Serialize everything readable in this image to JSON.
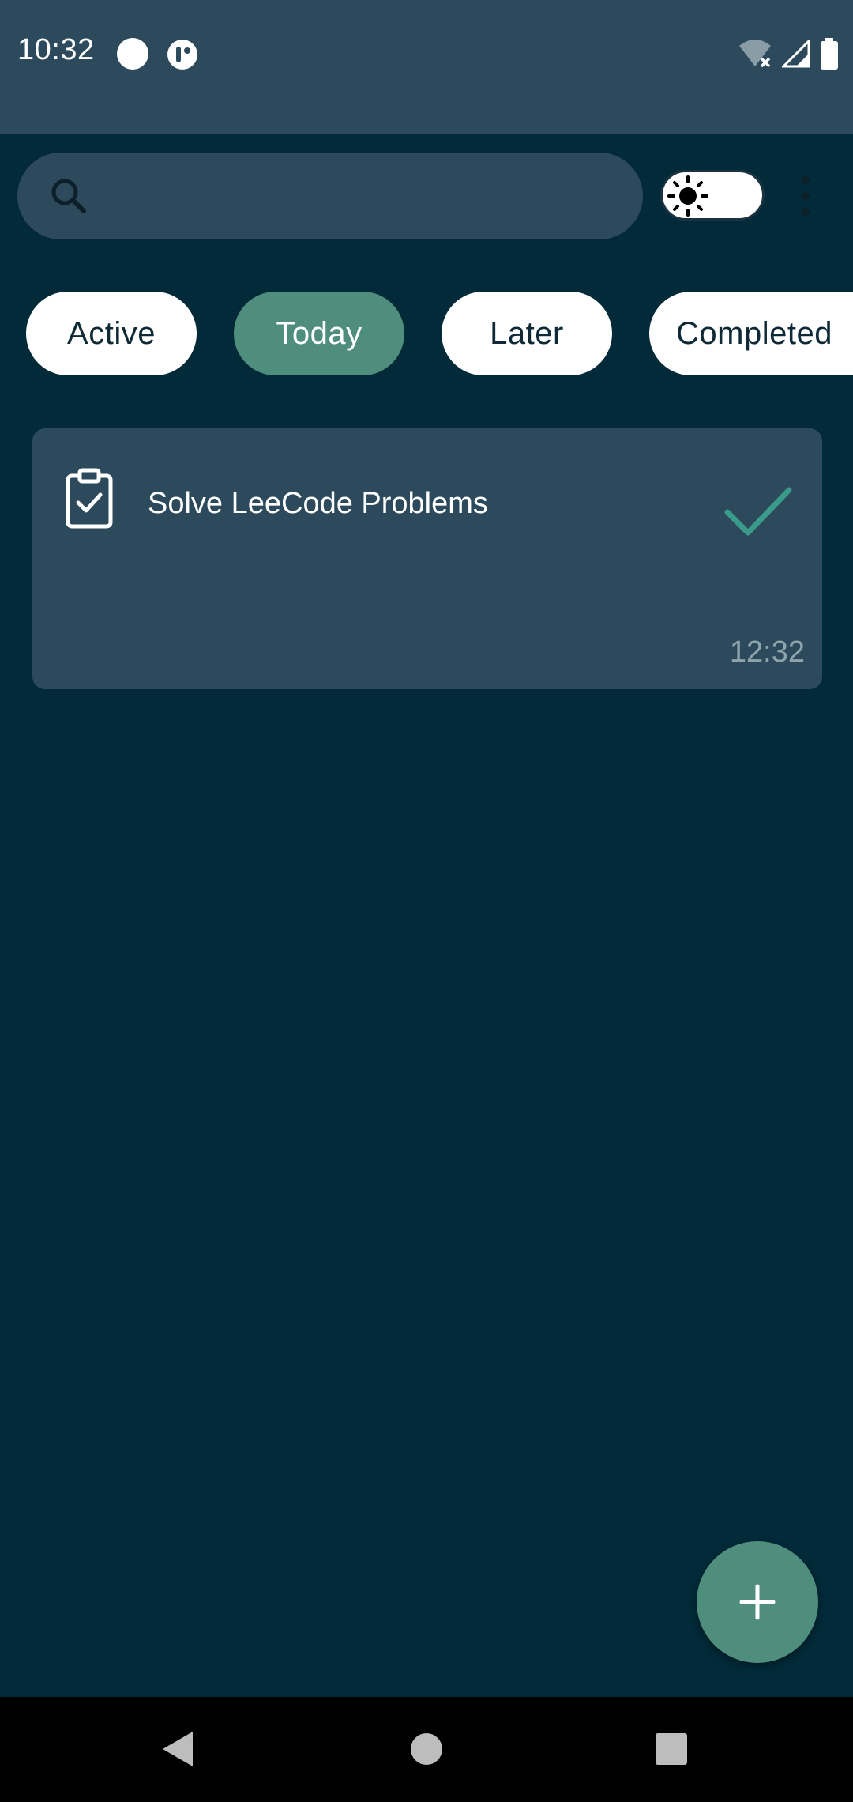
{
  "status_bar": {
    "time": "10:32",
    "icons": [
      "notification-dot-icon",
      "app-notification-icon",
      "wifi-off-icon",
      "cell-signal-icon",
      "battery-icon"
    ]
  },
  "search": {
    "placeholder": "",
    "value": "",
    "icon": "search-icon"
  },
  "theme_toggle": {
    "icon": "sun-icon",
    "state": "light"
  },
  "overflow_menu": {
    "icon": "more-vert-icon"
  },
  "tabs": [
    {
      "label": "Active",
      "selected": false
    },
    {
      "label": "Today",
      "selected": true
    },
    {
      "label": "Later",
      "selected": false
    },
    {
      "label": "Completed",
      "selected": false
    }
  ],
  "tasks": [
    {
      "icon": "clipboard-check-icon",
      "title": "Solve LeeCode Problems",
      "time": "12:32",
      "status_icon": "check-icon"
    }
  ],
  "fab": {
    "icon": "plus-icon"
  },
  "nav_bar": {
    "icons": [
      "back-icon",
      "home-icon",
      "recents-icon"
    ]
  },
  "colors": {
    "background": "#022a38",
    "surface": "#2c4a5b",
    "accent": "#4f8e7d",
    "check": "#3a9b8a",
    "muted_text": "#8fa3ad"
  }
}
